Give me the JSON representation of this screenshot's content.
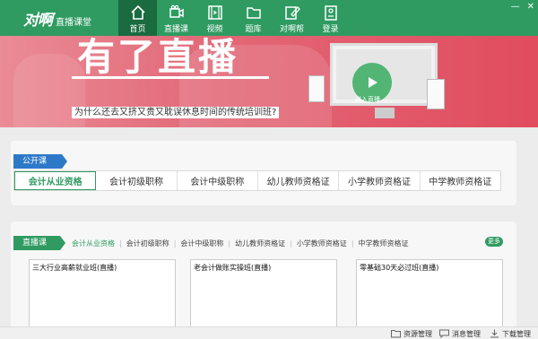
{
  "brand": {
    "logo": "对啊",
    "subtitle": "直播课堂"
  },
  "nav": [
    {
      "label": "首页",
      "icon": "home-icon",
      "active": true
    },
    {
      "label": "直播课",
      "icon": "video-camera-icon",
      "active": false
    },
    {
      "label": "视频",
      "icon": "film-icon",
      "active": false
    },
    {
      "label": "题库",
      "icon": "folder-icon",
      "active": false
    },
    {
      "label": "对啊帮",
      "icon": "edit-icon",
      "active": false
    },
    {
      "label": "登录",
      "icon": "id-card-icon",
      "active": false
    }
  ],
  "window_controls": {
    "minimize": "—",
    "close": "✕"
  },
  "banner": {
    "title": "有了直播",
    "caption": "为什么还去又挤又贵又耽误休息时间的传统培训班?",
    "enter_label": "进入直播"
  },
  "open_course": {
    "tag": "公开课",
    "tabs": [
      "会计从业资格",
      "会计初级职称",
      "会计中级职称",
      "幼儿教师资格证",
      "小学教师资格证",
      "中学教师资格证"
    ],
    "active_tab": 0
  },
  "live_course": {
    "tag": "直播课",
    "filters": [
      "会计从业资格",
      "会计初级职称",
      "会计中级职称",
      "幼儿教师资格证",
      "小学教师资格证",
      "中学教师资格证"
    ],
    "active_filter": 0,
    "more_label": "更多",
    "courses": [
      "三大行业高薪就业班(直播)",
      "老会计做账实操班(直播)",
      "零基础30天必过班(直播)"
    ]
  },
  "statusbar": {
    "resource": "资源管理",
    "message": "消息管理",
    "download": "下载管理"
  },
  "colors": {
    "brand_green": "#2f9b61",
    "nav_active": "#1b6b40",
    "tag_blue": "#2d79c8",
    "banner_red": "#e14c5e"
  }
}
